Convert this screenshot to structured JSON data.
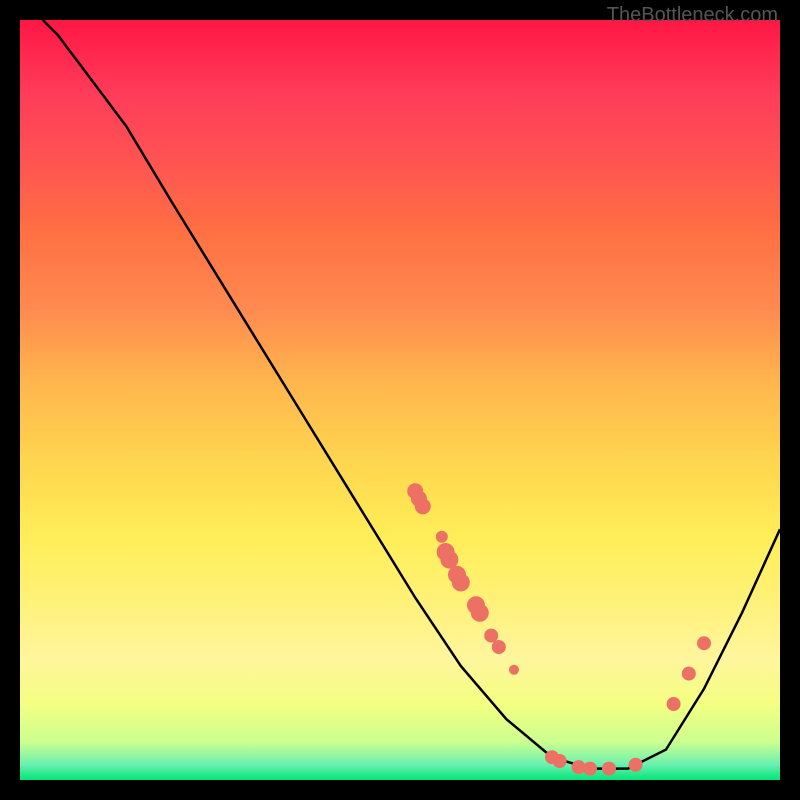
{
  "watermark": "TheBottleneck.com",
  "chart_data": {
    "type": "line",
    "title": "",
    "xlabel": "",
    "ylabel": "",
    "xlim": [
      0,
      100
    ],
    "ylim": [
      0,
      100
    ],
    "curve": [
      {
        "x": 3,
        "y": 100
      },
      {
        "x": 5,
        "y": 98
      },
      {
        "x": 8,
        "y": 94
      },
      {
        "x": 11,
        "y": 90
      },
      {
        "x": 14,
        "y": 86
      },
      {
        "x": 20,
        "y": 76
      },
      {
        "x": 28,
        "y": 63
      },
      {
        "x": 36,
        "y": 50
      },
      {
        "x": 44,
        "y": 37
      },
      {
        "x": 52,
        "y": 24
      },
      {
        "x": 58,
        "y": 15
      },
      {
        "x": 64,
        "y": 8
      },
      {
        "x": 70,
        "y": 3
      },
      {
        "x": 75,
        "y": 1.5
      },
      {
        "x": 80,
        "y": 1.5
      },
      {
        "x": 85,
        "y": 4
      },
      {
        "x": 90,
        "y": 12
      },
      {
        "x": 95,
        "y": 22
      },
      {
        "x": 100,
        "y": 33
      }
    ],
    "markers": [
      {
        "x": 52,
        "y": 38,
        "size": 8
      },
      {
        "x": 52.5,
        "y": 37,
        "size": 8
      },
      {
        "x": 53,
        "y": 36,
        "size": 8
      },
      {
        "x": 55.5,
        "y": 32,
        "size": 6
      },
      {
        "x": 56,
        "y": 30,
        "size": 9
      },
      {
        "x": 56.5,
        "y": 29,
        "size": 9
      },
      {
        "x": 57.5,
        "y": 27,
        "size": 9
      },
      {
        "x": 58,
        "y": 26,
        "size": 9
      },
      {
        "x": 60,
        "y": 23,
        "size": 9
      },
      {
        "x": 60.5,
        "y": 22,
        "size": 9
      },
      {
        "x": 62,
        "y": 19,
        "size": 7
      },
      {
        "x": 63,
        "y": 17.5,
        "size": 7
      },
      {
        "x": 65,
        "y": 14.5,
        "size": 5
      },
      {
        "x": 70,
        "y": 3,
        "size": 7
      },
      {
        "x": 71,
        "y": 2.5,
        "size": 7
      },
      {
        "x": 73.5,
        "y": 1.7,
        "size": 7
      },
      {
        "x": 75,
        "y": 1.5,
        "size": 7
      },
      {
        "x": 77.5,
        "y": 1.5,
        "size": 7
      },
      {
        "x": 81,
        "y": 2,
        "size": 7
      },
      {
        "x": 86,
        "y": 10,
        "size": 7
      },
      {
        "x": 88,
        "y": 14,
        "size": 7
      },
      {
        "x": 90,
        "y": 18,
        "size": 7
      }
    ],
    "marker_color": "#ec7063",
    "curve_color": "#000000"
  }
}
